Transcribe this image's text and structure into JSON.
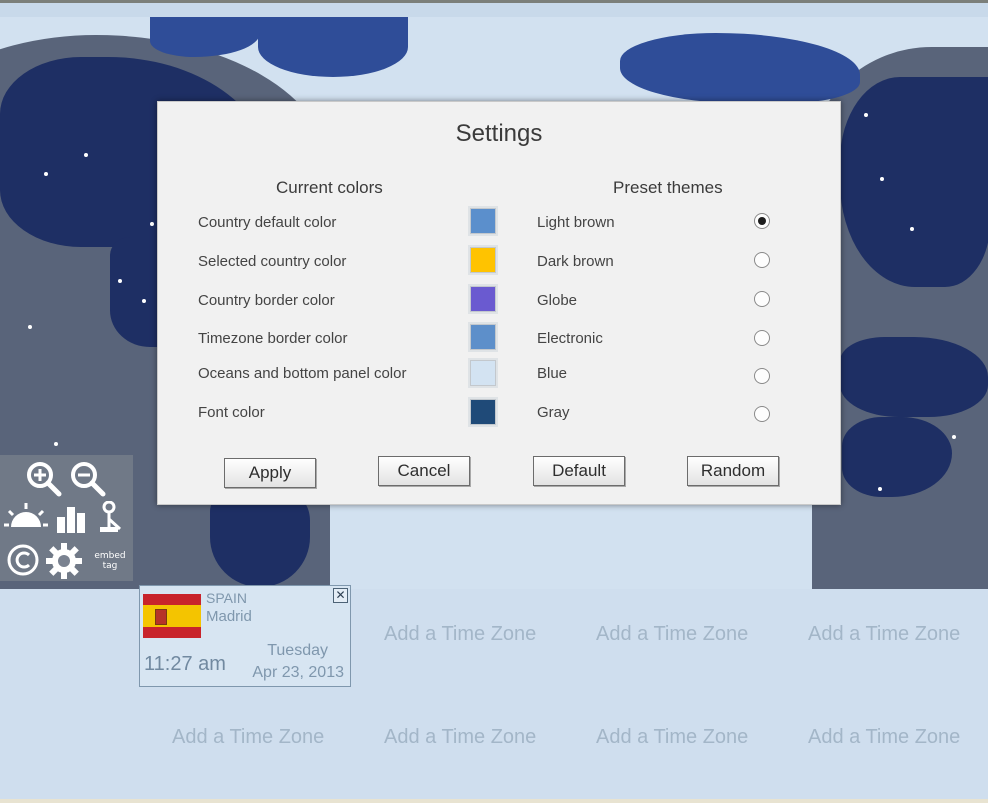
{
  "dialog": {
    "title": "Settings",
    "current_colors_header": "Current colors",
    "preset_themes_header": "Preset themes",
    "color_rows": [
      {
        "label": "Country default color",
        "color": "#5b8fcc"
      },
      {
        "label": "Selected country color",
        "color": "#ffc300"
      },
      {
        "label": "Country border color",
        "color": "#6a5ad0"
      },
      {
        "label": "Timezone border color",
        "color": "#5d8fca"
      },
      {
        "label": "Oceans and bottom panel color",
        "color": "#d3e3f2"
      },
      {
        "label": "Font color",
        "color": "#1f4a78"
      }
    ],
    "themes": [
      {
        "label": "Light brown",
        "selected": true
      },
      {
        "label": "Dark brown",
        "selected": false
      },
      {
        "label": "Globe",
        "selected": false
      },
      {
        "label": "Electronic",
        "selected": false
      },
      {
        "label": "Blue",
        "selected": false
      },
      {
        "label": "Gray",
        "selected": false
      }
    ],
    "buttons": {
      "apply": "Apply",
      "cancel": "Cancel",
      "default": "Default",
      "random": "Random"
    }
  },
  "toolbar": {
    "icons": [
      "zoom-in-icon",
      "zoom-out-icon",
      "daylight-icon",
      "city-icon",
      "lamp-icon",
      "copyright-icon",
      "gear-icon",
      "embed-tag-icon"
    ],
    "embed_label_line1": "embed",
    "embed_label_line2": "tag"
  },
  "timezone_card": {
    "country": "SPAIN",
    "city": "Madrid",
    "time": "11:27 am",
    "day": "Tuesday",
    "date": "Apr 23, 2013",
    "close_label": "✕"
  },
  "slots": {
    "add_label": "Add a Time Zone"
  },
  "colors": {
    "night": "#59647a",
    "land_night": "#1e2f64",
    "ocean": "#d2e1f0",
    "panel": "#cfdeee"
  }
}
